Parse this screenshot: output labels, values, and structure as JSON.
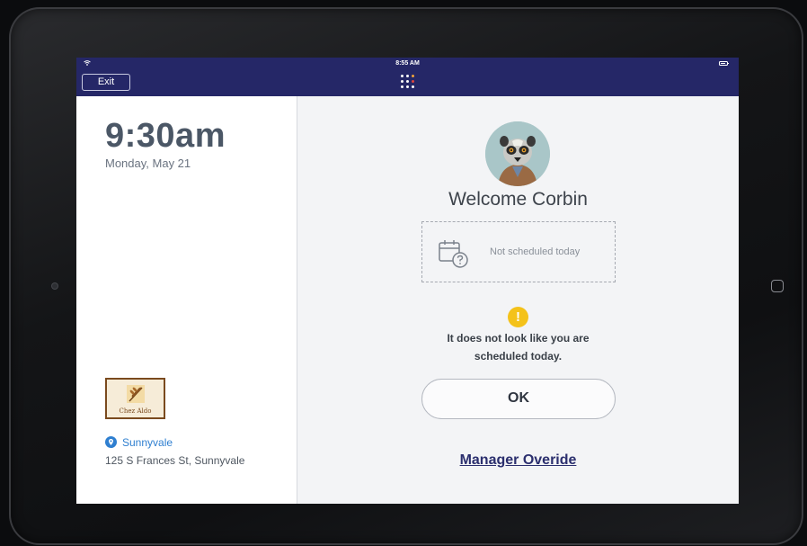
{
  "status_bar": {
    "time": "8:55 AM"
  },
  "header": {
    "exit_label": "Exit"
  },
  "left_panel": {
    "time": "9:30am",
    "date": "Monday, May 21",
    "logo_text": "Chez Aldo",
    "location_name": "Sunnyvale",
    "address": "125 S Frances St, Sunnyvale"
  },
  "main": {
    "welcome": "Welcome Corbin",
    "schedule_status": "Not scheduled today",
    "warning_line1": "It does not look like you are",
    "warning_line2": "scheduled today.",
    "ok_label": "OK",
    "manager_link": "Manager Overide"
  },
  "colors": {
    "topbar": "#252767",
    "link_blue": "#2f7fd0",
    "warning": "#f4c21a",
    "manager_link": "#2b2f6e"
  },
  "icons": [
    "wifi-icon",
    "battery-icon",
    "grid-icon",
    "pin-icon",
    "calendar-question-icon",
    "warning-icon",
    "home-button-icon"
  ]
}
